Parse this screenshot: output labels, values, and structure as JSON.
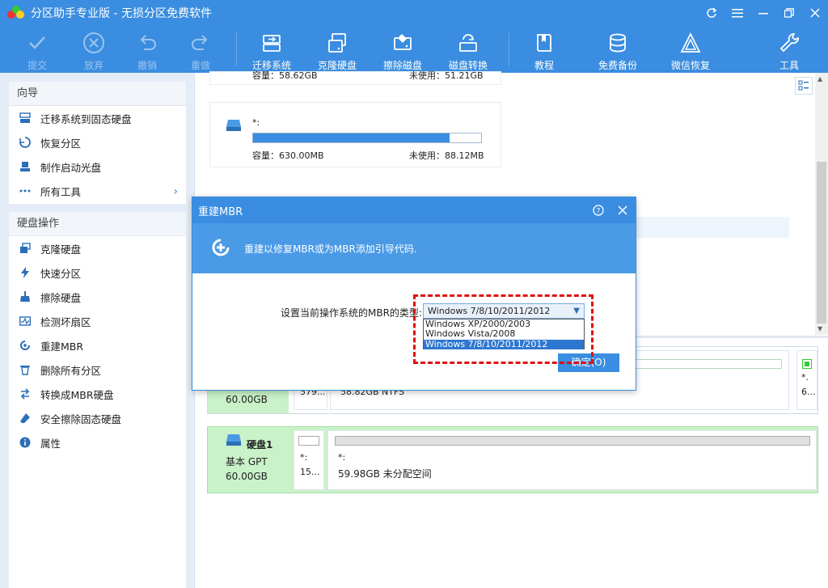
{
  "window": {
    "title": "分区助手专业版 - 无损分区免费软件"
  },
  "toolbar": {
    "items": [
      {
        "label": "提交",
        "icon": "check-icon",
        "enabled": false
      },
      {
        "label": "放弃",
        "icon": "cancel-icon",
        "enabled": false
      },
      {
        "label": "撤销",
        "icon": "undo-icon",
        "enabled": false
      },
      {
        "label": "重做",
        "icon": "redo-icon",
        "enabled": false
      },
      {
        "label": "迁移系统",
        "icon": "migrate-icon",
        "enabled": true
      },
      {
        "label": "克隆硬盘",
        "icon": "clone-disk-icon",
        "enabled": true
      },
      {
        "label": "擦除磁盘",
        "icon": "wipe-disk-icon",
        "enabled": true
      },
      {
        "label": "磁盘转换",
        "icon": "convert-disk-icon",
        "enabled": true
      },
      {
        "label": "教程",
        "icon": "book-icon",
        "enabled": true
      },
      {
        "label": "免费备份",
        "icon": "backup-icon",
        "enabled": true
      },
      {
        "label": "微信恢复",
        "icon": "recover-icon",
        "enabled": true
      },
      {
        "label": "工具",
        "icon": "wrench-icon",
        "enabled": true
      }
    ]
  },
  "sidebar": {
    "wizard": {
      "heading": "向导",
      "items": [
        "迁移系统到固态硬盘",
        "恢复分区",
        "制作启动光盘",
        "所有工具"
      ]
    },
    "disk_ops": {
      "heading": "硬盘操作",
      "items": [
        "克隆硬盘",
        "快速分区",
        "擦除硬盘",
        "检测坏扇区",
        "重建MBR",
        "删除所有分区",
        "转换成MBR硬盘",
        "安全擦除固态硬盘",
        "属性"
      ]
    }
  },
  "main": {
    "top_card": {
      "capacity": "容量：58.62GB",
      "unused": "未使用：51.21GB"
    },
    "card2": {
      "name": "*:",
      "capacity": "容量：630.00MB",
      "unused": "未使用：88.12MB",
      "usage_fraction": 0.86
    },
    "disk0": {
      "size": "60.00GB",
      "part_small": "579...",
      "part_main": "58.82GB NTFS",
      "part_right_name": "*.",
      "part_right_size": "6..."
    },
    "disk1": {
      "name": "硬盘1",
      "type": "基本 GPT",
      "size": "60.00GB",
      "part_small_name": "*:",
      "part_small_size": "15...",
      "part_main_name": "*:",
      "part_main_desc": "59.98GB 未分配空间"
    }
  },
  "dialog": {
    "title": "重建MBR",
    "banner_text": "重建以修复MBR或为MBR添加引导代码.",
    "prompt_label": "设置当前操作系统的MBR的类型:",
    "selected": "Windows 7/8/10/2011/2012",
    "options": [
      "Windows XP/2000/2003",
      "Windows Vista/2008",
      "Windows 7/8/10/2011/2012"
    ],
    "ok_label": "确定(O)"
  },
  "colors": {
    "primary": "#3a8de0",
    "sidebar_bg": "#e4edf7",
    "disk_info_green": "#c9f2c9",
    "highlight_red": "#e01010"
  }
}
